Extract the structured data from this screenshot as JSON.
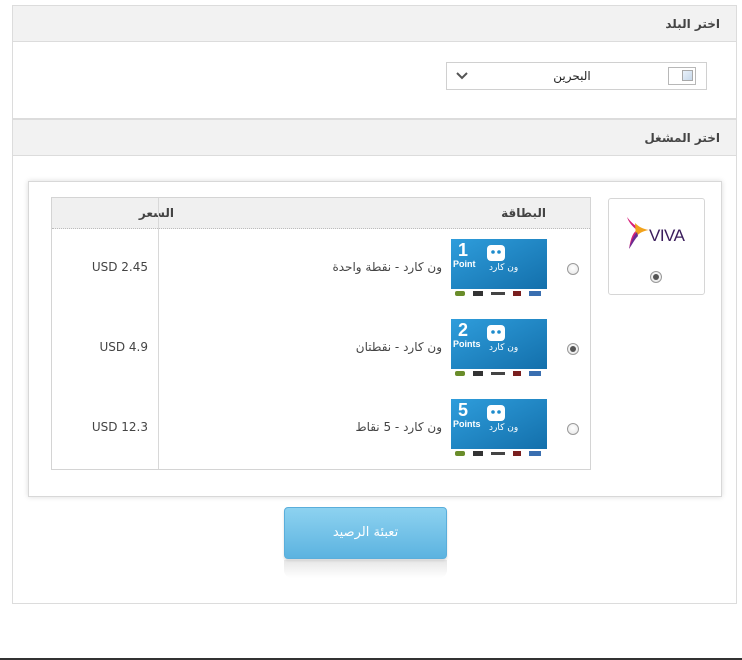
{
  "country_section": {
    "title": "اختر البلد",
    "selected_country": "البحرين"
  },
  "operator_section": {
    "title": "اختر المشغل",
    "operator": {
      "name": "VIVA",
      "selected": true
    }
  },
  "cards_table": {
    "headers": {
      "card": "البطاقة",
      "price": "السعر"
    },
    "rows": [
      {
        "name": "ون كارد - نقطة واحدة",
        "price": "USD 2.45",
        "points_label": "1",
        "points_unit": "Point",
        "selected": false
      },
      {
        "name": "ون كارد - نقطتان",
        "price": "USD 4.9",
        "points_label": "2",
        "points_unit": "Points",
        "selected": true
      },
      {
        "name": "ون كارد - 5 نقاط",
        "price": "USD 12.3",
        "points_label": "5",
        "points_unit": "Points",
        "selected": false
      }
    ],
    "card_brand_text": "ون كارد"
  },
  "submit_button": {
    "label": "تعبئة الرصيد"
  },
  "colors": {
    "button": "#6cc0e8",
    "card_bg": "#1c86c6",
    "panel_header": "#f2f2f2"
  }
}
